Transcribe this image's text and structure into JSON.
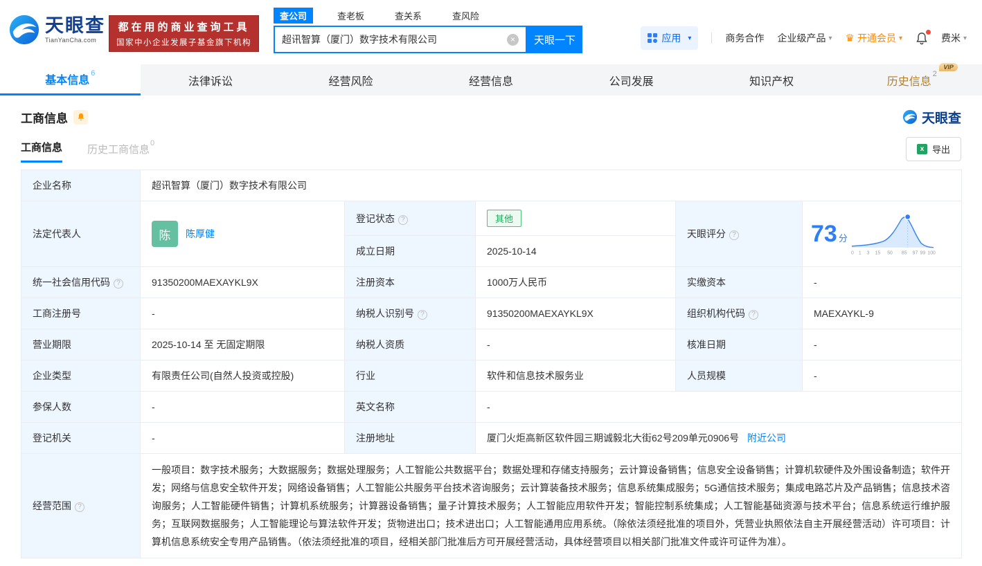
{
  "colors": {
    "accent_blue": "#0084ff",
    "score_blue": "#2f7ef7",
    "banner_red": "#b5312d",
    "status_green": "#1fad5c",
    "avatar_green": "#65c0a2",
    "member_orange": "#ff8a00",
    "vip_gold": "#e8b86a",
    "label_cell_bg": "#eef6ff"
  },
  "header": {
    "logo_title": "天眼查",
    "logo_sub": "TianYanCha.com",
    "slogan_line1": "都在用的商业查询工具",
    "slogan_line2": "国家中小企业发展子基金旗下机构",
    "search_tabs": [
      {
        "label": "查公司"
      },
      {
        "label": "查老板"
      },
      {
        "label": "查关系"
      },
      {
        "label": "查风险"
      }
    ],
    "search_value": "超讯智算（厦门）数字技术有限公司",
    "search_button": "天眼一下",
    "menu": {
      "app": "应用",
      "cooperation": "商务合作",
      "enterprise": "企业级产品",
      "vip": "开通会员",
      "user": "费米"
    }
  },
  "nav": {
    "vip_badge": "VIP",
    "tabs": [
      {
        "label": "基本信息",
        "count": "6"
      },
      {
        "label": "法律诉讼",
        "count": ""
      },
      {
        "label": "经营风险",
        "count": ""
      },
      {
        "label": "经营信息",
        "count": ""
      },
      {
        "label": "公司发展",
        "count": ""
      },
      {
        "label": "知识产权",
        "count": ""
      },
      {
        "label": "历史信息",
        "count": "2"
      }
    ]
  },
  "section": {
    "title": "工商信息",
    "brand": "天眼查",
    "subtabs": [
      {
        "label": "工商信息",
        "count": ""
      },
      {
        "label": "历史工商信息",
        "count": "0"
      }
    ],
    "export_label": "导出"
  },
  "company": {
    "name_label": "企业名称",
    "name": "超讯智算（厦门）数字技术有限公司",
    "legal_label": "法定代表人",
    "legal_avatar": "陈",
    "legal_name": "陈厚健",
    "status_label": "登记状态",
    "status": "其他",
    "established_label": "成立日期",
    "established": "2025-10-14",
    "uscc_label": "统一社会信用代码",
    "uscc": "91350200MAEXAYKL9X",
    "reg_capital_label": "注册资本",
    "reg_capital": "1000万人民币",
    "paid_capital_label": "实缴资本",
    "paid_capital": "-",
    "reg_no_label": "工商注册号",
    "reg_no": "-",
    "taxpayer_id_label": "纳税人识别号",
    "taxpayer_id": "91350200MAEXAYKL9X",
    "org_code_label": "组织机构代码",
    "org_code": "MAEXAYKL-9",
    "term_label": "营业期限",
    "term": "2025-10-14 至 无固定期限",
    "taxpayer_qual_label": "纳税人资质",
    "taxpayer_qual": "-",
    "approve_date_label": "核准日期",
    "approve_date": "-",
    "type_label": "企业类型",
    "type": "有限责任公司(自然人投资或控股)",
    "industry_label": "行业",
    "industry": "软件和信息技术服务业",
    "staff_label": "人员规模",
    "staff": "-",
    "insured_label": "参保人数",
    "insured": "-",
    "en_name_label": "英文名称",
    "en_name": "-",
    "registry_label": "登记机关",
    "registry": "-",
    "address_label": "注册地址",
    "address": "厦门火炬高新区软件园三期诚毅北大街62号209单元0906号",
    "address_link": "附近公司",
    "scope_label": "经营范围",
    "scope": "一般项目：数字技术服务；大数据服务；数据处理服务；人工智能公共数据平台；数据处理和存储支持服务；云计算设备销售；信息安全设备销售；计算机软硬件及外围设备制造；软件开发；网络与信息安全软件开发；网络设备销售；人工智能公共服务平台技术咨询服务；云计算装备技术服务；信息系统集成服务；5G通信技术服务；集成电路芯片及产品销售；信息技术咨询服务；人工智能硬件销售；计算机系统服务；计算器设备销售；量子计算技术服务；人工智能应用软件开发；智能控制系统集成；人工智能基础资源与技术平台；信息系统运行维护服务；互联网数据服务；人工智能理论与算法软件开发；货物进出口；技术进出口；人工智能通用应用系统。（除依法须经批准的项目外，凭营业执照依法自主开展经营活动）许可项目：计算机信息系统安全专用产品销售。（依法须经批准的项目，经相关部门批准后方可开展经营活动，具体经营项目以相关部门批准文件或许可证件为准）。"
  },
  "score": {
    "label": "天眼评分",
    "value": "73",
    "unit": "分",
    "ticks": [
      "0",
      "1",
      "3",
      "15",
      "50",
      "85",
      "97",
      "99",
      "100"
    ]
  }
}
